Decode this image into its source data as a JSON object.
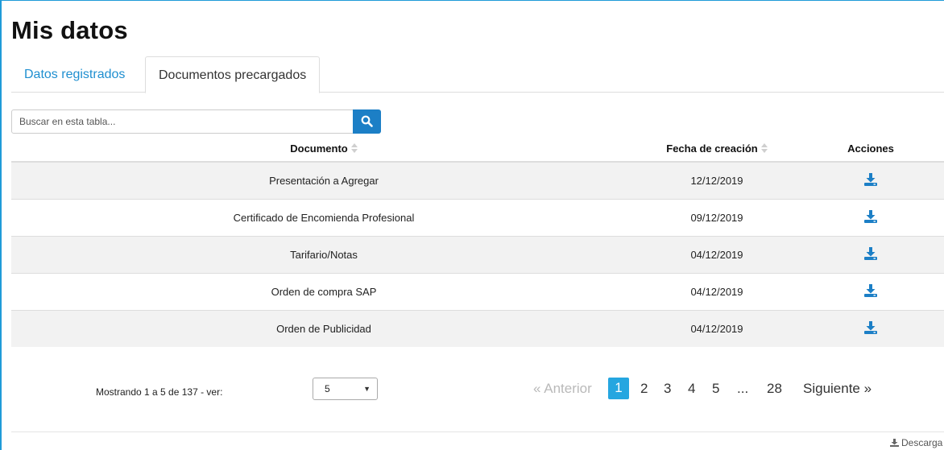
{
  "page": {
    "title": "Mis datos"
  },
  "tabs": [
    {
      "label": "Datos registrados",
      "active": false
    },
    {
      "label": "Documentos precargados",
      "active": true
    }
  ],
  "search": {
    "placeholder": "Buscar en esta tabla...",
    "icon": "search-icon"
  },
  "table": {
    "headers": {
      "document": "Documento",
      "date": "Fecha de creación",
      "actions": "Acciones"
    },
    "rows": [
      {
        "document": "Presentación a Agregar",
        "date": "12/12/2019",
        "action_icon": "download-icon"
      },
      {
        "document": "Certificado de Encomienda Profesional",
        "date": "09/12/2019",
        "action_icon": "download-icon"
      },
      {
        "document": "Tarifario/Notas",
        "date": "04/12/2019",
        "action_icon": "download-icon"
      },
      {
        "document": "Orden de compra SAP",
        "date": "04/12/2019",
        "action_icon": "download-icon"
      },
      {
        "document": "Orden de Publicidad",
        "date": "04/12/2019",
        "action_icon": "download-icon"
      }
    ]
  },
  "footer": {
    "showing": "Mostrando 1 a 5 de 137 - ver:",
    "page_size": "5",
    "prev": "« Anterior",
    "pages": [
      "1",
      "2",
      "3",
      "4",
      "5",
      "...",
      "28"
    ],
    "current_page": "1",
    "next": "Siguiente »",
    "download": "Descarga"
  },
  "colors": {
    "accent": "#1f8fd0",
    "button": "#1c7fc6",
    "active_page": "#25a6e0",
    "stripe": "#f2f2f2"
  }
}
